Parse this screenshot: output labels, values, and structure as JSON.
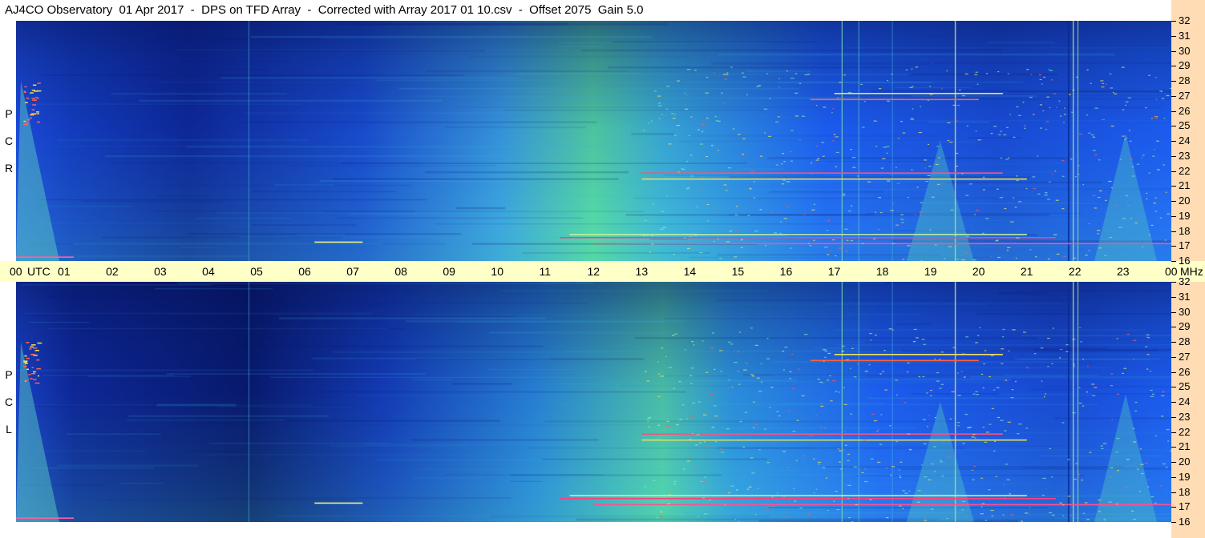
{
  "title": "AJ4CO Observatory  01 Apr 2017  -  DPS on TFD Array  -  Corrected with Array 2017 01 10.csv  -  Offset 2075  Gain 5.0",
  "colors": {
    "low": "#0a1a6e",
    "mid": "#1e64ff",
    "high": "#50dc96",
    "peak": "#ff3c78",
    "time_axis_bg": "#ffffc8",
    "freq_axis_bg": "#ffdcb4"
  },
  "chart_data": [
    {
      "type": "heatmap",
      "panel": "RCP",
      "side_label": [
        "R",
        "C",
        "P"
      ],
      "x_unit": "UTC",
      "x_range": [
        0,
        24
      ],
      "y_unit": "MHz",
      "y_range": [
        16,
        32
      ],
      "y_ticks": [
        "32",
        "31",
        "30",
        "29",
        "28",
        "27",
        "26",
        "25",
        "24",
        "23",
        "22",
        "21",
        "20",
        "19",
        "18",
        "17",
        "16"
      ]
    },
    {
      "type": "heatmap",
      "panel": "LCP",
      "side_label": [
        "L",
        "C",
        "P"
      ],
      "x_unit": "UTC",
      "x_range": [
        0,
        24
      ],
      "y_unit": "MHz",
      "y_range": [
        16,
        32
      ],
      "y_ticks": [
        "32",
        "31",
        "30",
        "29",
        "28",
        "27",
        "26",
        "25",
        "24",
        "23",
        "22",
        "21",
        "20",
        "19",
        "18",
        "17",
        "16"
      ]
    }
  ],
  "time_axis": {
    "labels": [
      "00",
      "UTC",
      "01",
      "02",
      "03",
      "04",
      "05",
      "06",
      "07",
      "08",
      "09",
      "10",
      "11",
      "12",
      "13",
      "14",
      "15",
      "16",
      "17",
      "18",
      "19",
      "20",
      "21",
      "22",
      "23",
      "00"
    ],
    "unit_right": "MHz"
  }
}
